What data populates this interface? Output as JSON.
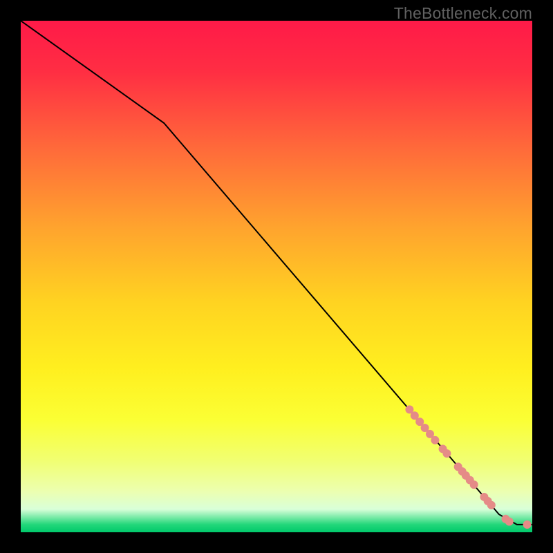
{
  "watermark": "TheBottleneck.com",
  "chart_data": {
    "type": "line",
    "title": "",
    "xlabel": "",
    "ylabel": "",
    "xlim": [
      0,
      100
    ],
    "ylim": [
      0,
      100
    ],
    "grid": false,
    "legend": false,
    "gradient_stops": [
      {
        "offset": 0.0,
        "color": "#ff1a48"
      },
      {
        "offset": 0.1,
        "color": "#ff2e43"
      },
      {
        "offset": 0.25,
        "color": "#ff6a3a"
      },
      {
        "offset": 0.4,
        "color": "#ffa22e"
      },
      {
        "offset": 0.55,
        "color": "#ffd321"
      },
      {
        "offset": 0.68,
        "color": "#ffef1f"
      },
      {
        "offset": 0.78,
        "color": "#fbff34"
      },
      {
        "offset": 0.86,
        "color": "#f1ff72"
      },
      {
        "offset": 0.92,
        "color": "#ecffb0"
      },
      {
        "offset": 0.955,
        "color": "#d9ffd9"
      },
      {
        "offset": 0.985,
        "color": "#22d77a"
      },
      {
        "offset": 1.0,
        "color": "#00c96b"
      }
    ],
    "series": [
      {
        "name": "curve",
        "type": "line",
        "color": "#000000",
        "x": [
          0,
          28,
          93.5,
          97,
          100
        ],
        "y": [
          100,
          80,
          3.5,
          1.5,
          1.5
        ]
      },
      {
        "name": "markers",
        "type": "scatter",
        "color": "#e58b87",
        "radius": 6,
        "points": [
          {
            "x": 76.0,
            "y": 24.0
          },
          {
            "x": 77.0,
            "y": 22.8
          },
          {
            "x": 78.0,
            "y": 21.6
          },
          {
            "x": 79.0,
            "y": 20.4
          },
          {
            "x": 80.0,
            "y": 19.2
          },
          {
            "x": 81.0,
            "y": 18.0
          },
          {
            "x": 82.5,
            "y": 16.3
          },
          {
            "x": 83.3,
            "y": 15.4
          },
          {
            "x": 85.5,
            "y": 12.8
          },
          {
            "x": 86.3,
            "y": 11.9
          },
          {
            "x": 87.0,
            "y": 11.1
          },
          {
            "x": 87.8,
            "y": 10.2
          },
          {
            "x": 88.6,
            "y": 9.3
          },
          {
            "x": 90.6,
            "y": 6.9
          },
          {
            "x": 91.3,
            "y": 6.1
          },
          {
            "x": 92.0,
            "y": 5.3
          },
          {
            "x": 94.8,
            "y": 2.6
          },
          {
            "x": 95.5,
            "y": 2.1
          },
          {
            "x": 99.0,
            "y": 1.5
          }
        ]
      }
    ]
  }
}
